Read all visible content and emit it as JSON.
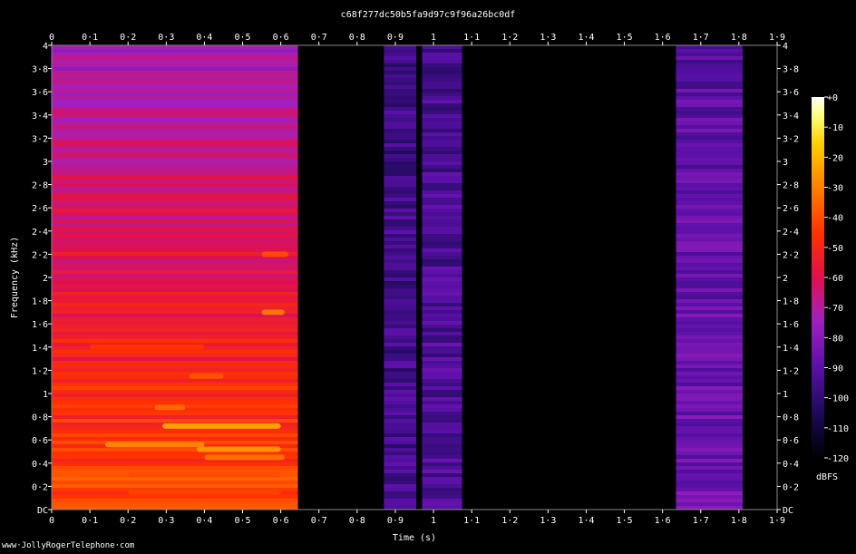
{
  "chart_data": {
    "type": "heatmap",
    "title": "c68f277dc50b5fa9d97c9f96a26bc0df",
    "xlabel": "Time (s)",
    "ylabel": "Frequency (kHz)",
    "xlim": [
      0,
      1.9
    ],
    "ylim": [
      0,
      4
    ],
    "x_ticks": [
      "0",
      "0·1",
      "0·2",
      "0·3",
      "0·4",
      "0·5",
      "0·6",
      "0·7",
      "0·8",
      "0·9",
      "1",
      "1·1",
      "1·2",
      "1·3",
      "1·4",
      "1·5",
      "1·6",
      "1·7",
      "1·8",
      "1·9"
    ],
    "y_ticks": [
      "DC",
      "0·2",
      "0·4",
      "0·6",
      "0·8",
      "1",
      "1·2",
      "1·4",
      "1·6",
      "1·8",
      "2",
      "2·2",
      "2·4",
      "2·6",
      "2·8",
      "3",
      "3·2",
      "3·4",
      "3·6",
      "3·8",
      "4"
    ],
    "colorbar": {
      "label": "dBFS",
      "ticks": [
        "+0",
        "-10",
        "-20",
        "-30",
        "-40",
        "-50",
        "-60",
        "-70",
        "-80",
        "-90",
        "-100",
        "-110",
        "-120"
      ],
      "range": [
        -120,
        0
      ],
      "colormap": [
        "#000000",
        "#1a0a55",
        "#5a10a8",
        "#a020c0",
        "#e01050",
        "#ff3000",
        "#ff8000",
        "#ffd000",
        "#ffff80",
        "#ffffff"
      ]
    },
    "segments": [
      {
        "t_start": 0.0,
        "t_end": 0.645,
        "level_db_low_freq": -40,
        "level_db_high_freq": -75
      },
      {
        "t_start": 0.87,
        "t_end": 0.955,
        "level_db_low_freq": -95,
        "level_db_high_freq": -97
      },
      {
        "t_start": 0.97,
        "t_end": 1.075,
        "level_db_low_freq": -92,
        "level_db_high_freq": -95
      },
      {
        "t_start": 1.635,
        "t_end": 1.81,
        "level_db_low_freq": -85,
        "level_db_high_freq": -90
      }
    ],
    "hot_spots": [
      {
        "t_start": 0.29,
        "t_end": 0.6,
        "f_khz": 0.72,
        "level_db": -22
      },
      {
        "t_start": 0.38,
        "t_end": 0.6,
        "f_khz": 0.52,
        "level_db": -25
      },
      {
        "t_start": 0.14,
        "t_end": 0.4,
        "f_khz": 0.56,
        "level_db": -28
      },
      {
        "t_start": 0.4,
        "t_end": 0.61,
        "f_khz": 0.45,
        "level_db": -32
      },
      {
        "t_start": 0.27,
        "t_end": 0.35,
        "f_khz": 0.88,
        "level_db": -34
      },
      {
        "t_start": 0.55,
        "t_end": 0.61,
        "f_khz": 1.7,
        "level_db": -30
      },
      {
        "t_start": 0.36,
        "t_end": 0.45,
        "f_khz": 1.15,
        "level_db": -38
      },
      {
        "t_start": 0.55,
        "t_end": 0.62,
        "f_khz": 2.2,
        "level_db": -40
      },
      {
        "t_start": 0.1,
        "t_end": 0.4,
        "f_khz": 1.4,
        "level_db": -45
      },
      {
        "t_start": 0.2,
        "t_end": 0.6,
        "f_khz": 0.3,
        "level_db": -40
      },
      {
        "t_start": 0.2,
        "t_end": 0.6,
        "f_khz": 0.15,
        "level_db": -42
      }
    ]
  },
  "footer": {
    "credit": "www·JollyRogerTelephone·com"
  }
}
